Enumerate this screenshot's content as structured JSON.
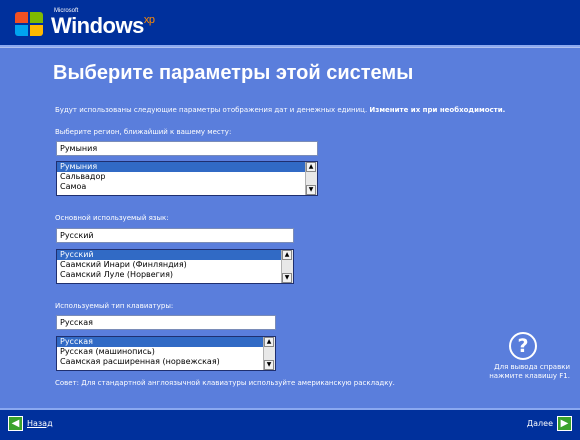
{
  "header": {
    "brand_small": "Microsoft",
    "brand_name": "Windows",
    "brand_sup": "xp"
  },
  "page": {
    "title": "Выберите параметры этой системы",
    "intro": "Будут использованы следующие параметры отображения дат и денежных единиц.",
    "intro_bold": "Измените их при необходимости."
  },
  "region": {
    "label": "Выберите регион, ближайший к вашему месту:",
    "value": "Румыния",
    "options": [
      "Румыния",
      "Сальвадор",
      "Самоа"
    ],
    "selected_index": 0
  },
  "language": {
    "label": "Основной используемый язык:",
    "value": "Русский",
    "options": [
      "Русский",
      "Саамский Инари (Финляндия)",
      "Саамский Луле (Норвегия)"
    ],
    "selected_index": 0
  },
  "keyboard": {
    "label": "Используемый тип клавиатуры:",
    "value": "Русская",
    "options": [
      "Русская",
      "Русская (машинопись)",
      "Саамская расширенная (норвежская)"
    ],
    "selected_index": 0
  },
  "tip": "Совет: Для стандартной англоязычной клавиатуры используйте американскую раскладку.",
  "help": {
    "icon": "question-icon",
    "line1": "Для вывода справки",
    "line2": "нажмите клавишу F1."
  },
  "nav": {
    "back_label": "Назад",
    "next_label": "Далее"
  },
  "colors": {
    "background": "#5a7edc",
    "bar": "#00309c",
    "selection": "#316ac5",
    "nav_arrow": "#3ba22b"
  }
}
